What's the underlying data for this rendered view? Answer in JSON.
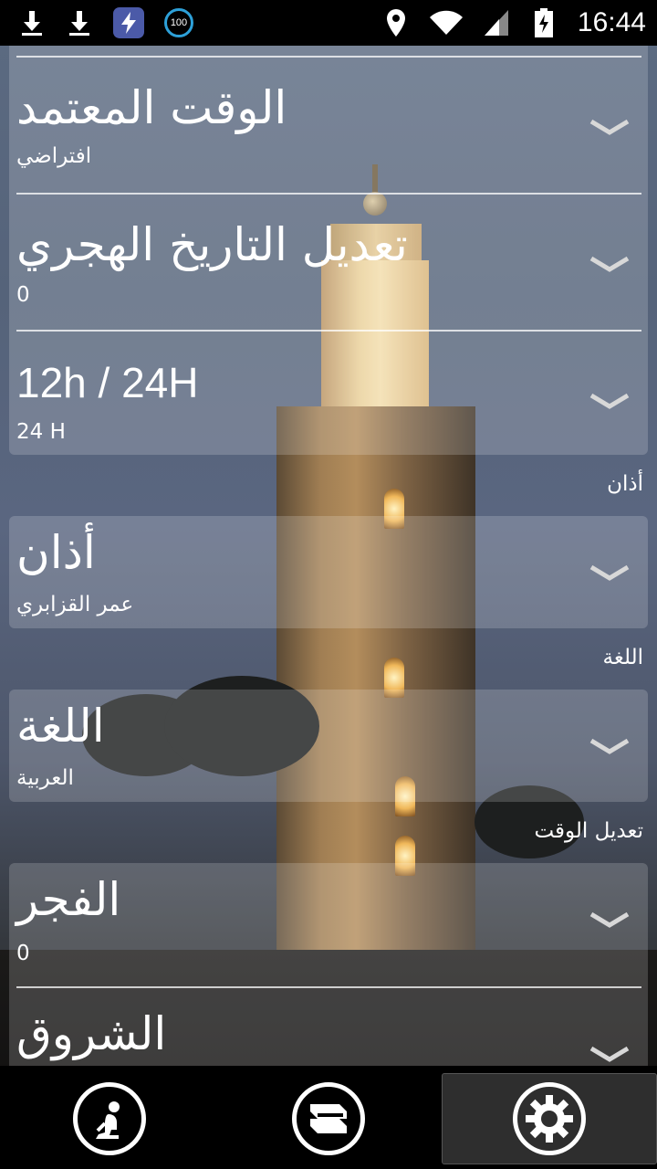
{
  "status_bar": {
    "time": "16:44",
    "left_icons": [
      "download-icon",
      "download-icon",
      "bolt-app-icon",
      "battery-100-badge-icon"
    ],
    "badge_text": "100",
    "right_icons": [
      "location-icon",
      "wifi-icon",
      "signal-icon",
      "battery-charging-icon"
    ]
  },
  "settings": {
    "card1": {
      "rows": [
        {
          "title": "الوقت المعتمد",
          "value": "افتراضي"
        },
        {
          "title": "تعديل التاريخ الهجري",
          "value": "0"
        },
        {
          "title": "12h / 24H",
          "value": "24 H"
        }
      ]
    },
    "adhan_section": {
      "label": "أذان",
      "row": {
        "title": "أذان",
        "value": "عمر القزابري"
      }
    },
    "language_section": {
      "label": "اللغة",
      "row": {
        "title": "اللغة",
        "value": "العربية"
      }
    },
    "time_adjust_section": {
      "label": "تعديل الوقت",
      "rows": [
        {
          "title": "الفجر",
          "value": "0"
        },
        {
          "title": "الشروق",
          "value": ""
        }
      ]
    }
  },
  "bottom_nav": {
    "items": [
      {
        "icon": "prayer-person-icon",
        "active": false
      },
      {
        "icon": "book-quran-icon",
        "active": false
      },
      {
        "icon": "gear-icon",
        "active": true
      }
    ]
  },
  "colors": {
    "status_bar_bg": "#000000",
    "card_bg": "rgba(255,255,255,0.18)",
    "text": "#ffffff",
    "badge_ring": "#2da0d8"
  }
}
